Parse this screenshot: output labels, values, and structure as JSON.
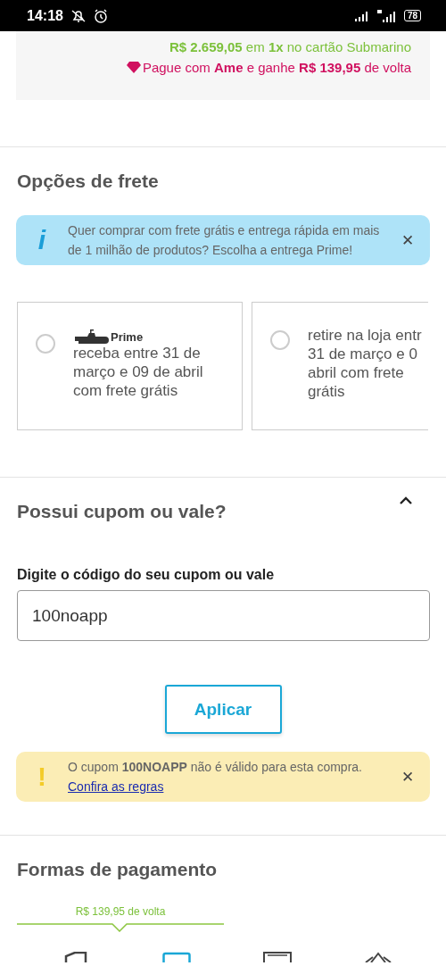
{
  "status_bar": {
    "time": "14:18",
    "battery": "78"
  },
  "price_box": {
    "card_offer": "**R$ 2.659,05** em **1x** no cartão Submarino",
    "ame_offer": "Pague com **Ame** e ganhe **R$ 139,95** de volta"
  },
  "shipping": {
    "title": "Opções de frete",
    "banner": {
      "icon": "i",
      "text": "Quer comprar com frete grátis e entrega rápida em mais de 1 milhão de produtos? Escolha a entrega Prime!",
      "close": "✕"
    },
    "options": [
      {
        "kind": "prime",
        "badge": "Prime",
        "lines": [
          "receba entre 31 de",
          "março e 09 de abril",
          "com frete grátis"
        ],
        "selected": false
      },
      {
        "kind": "store",
        "lines": [
          "retire na loja entr",
          "31 de março e 0",
          "abril com frete",
          "grátis"
        ],
        "selected": false
      }
    ]
  },
  "coupon": {
    "title": "Possui cupom ou vale?",
    "expanded": true,
    "label": "Digite o código do seu cupom ou vale",
    "value": "100noapp",
    "button": "Aplicar",
    "alert": {
      "icon": "!",
      "text": "O cupom **100NOAPP** não é válido para esta compra.",
      "link": "Confira as regras",
      "close": "✕"
    }
  },
  "payment": {
    "title": "Formas de pagamento",
    "cashback": "R$ 139,95 de volta"
  }
}
